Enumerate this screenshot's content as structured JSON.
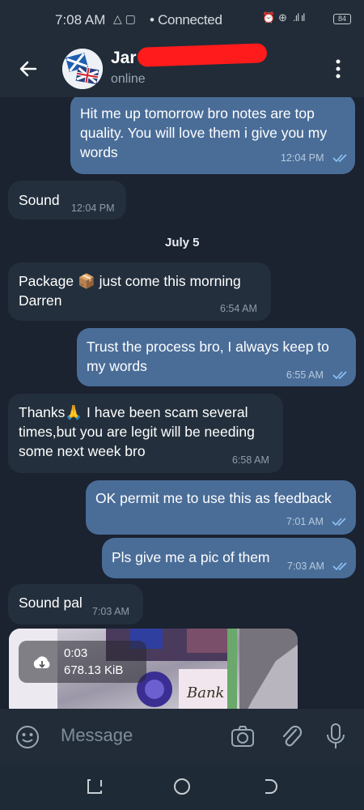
{
  "status_bar": {
    "time": "7:08 AM",
    "connection": "Connected",
    "battery": "84"
  },
  "header": {
    "contact_name": "Jar",
    "status": "online"
  },
  "messages": [
    {
      "direction": "out",
      "text": "Hit me up tomorrow bro notes are top quality. You will love them i give you my words",
      "time": "12:04 PM",
      "read": true
    },
    {
      "direction": "in",
      "text": "Sound",
      "time": "12:04 PM"
    },
    {
      "direction": "in",
      "text": "Package 📦 just come this morning Darren",
      "time": "6:54 AM"
    },
    {
      "direction": "out",
      "text": "Trust the process bro, I always keep to my words",
      "time": "6:55 AM",
      "read": true
    },
    {
      "direction": "in",
      "text": "Thanks🙏 I have been scam several times,but you are legit will be needing some next week bro",
      "time": "6:58 AM"
    },
    {
      "direction": "out",
      "text": "OK permit me to use this as feedback",
      "time": "7:01 AM",
      "read": true
    },
    {
      "direction": "out",
      "text": "Pls give me a pic of them",
      "time": "7:03 AM",
      "read": true
    },
    {
      "direction": "in",
      "text": "Sound pal",
      "time": "7:03 AM"
    }
  ],
  "date_separator": "July 5",
  "media_message": {
    "duration": "0:03",
    "size": "678.13 KiB"
  },
  "input": {
    "placeholder": "Message"
  },
  "colors": {
    "background": "#1b2230",
    "header": "#212c38",
    "outgoing_bubble": "#4a6d98",
    "incoming_bubble": "#232f3c",
    "read_ticks": "#8ec3f5"
  },
  "icons": [
    "back-arrow-icon",
    "more-vert-icon",
    "emoji-icon",
    "camera-icon",
    "attach-icon",
    "mic-icon",
    "download-icon"
  ]
}
